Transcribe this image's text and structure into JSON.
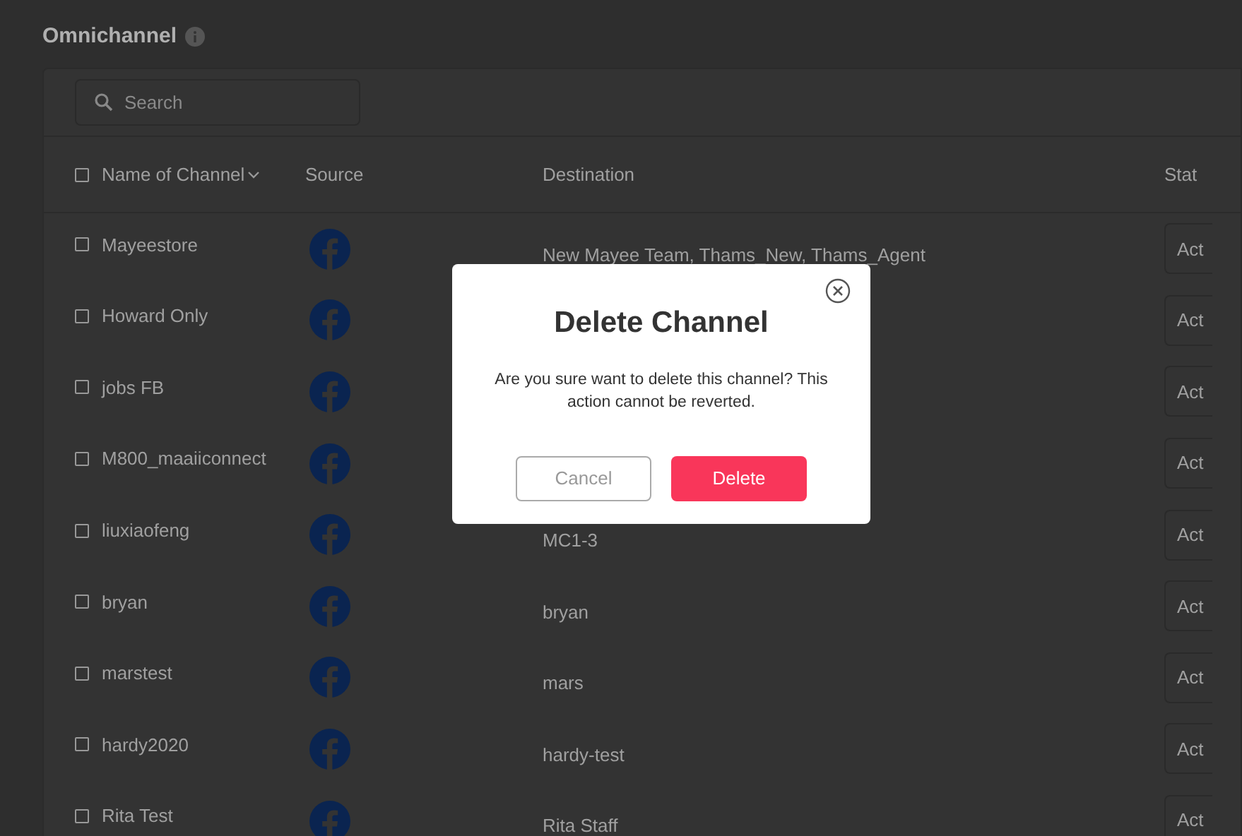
{
  "page": {
    "title": "Omnichannel"
  },
  "search": {
    "placeholder": "Search"
  },
  "table": {
    "select_all": {
      "checked": false
    },
    "columns": [
      "Name of Channel",
      "Source",
      "Destination",
      "Stat"
    ],
    "rows": [
      {
        "name": "Mayeestore",
        "checked": false,
        "destination": "New Mayee Team, Thams_New, Thams_Agent",
        "status": "Act"
      },
      {
        "name": "Howard Only",
        "checked": false,
        "status": "Act"
      },
      {
        "name": "jobs FB",
        "checked": false,
        "status": "Act"
      },
      {
        "name": "M800_maaiiconnect",
        "checked": false,
        "status": "Act"
      },
      {
        "name": "liuxiaofeng",
        "checked": false,
        "destination": "MC1-3",
        "status": "Act"
      },
      {
        "name": "bryan",
        "checked": false,
        "destination": "bryan",
        "status": "Act"
      },
      {
        "name": "marstest",
        "checked": false,
        "destination": "mars",
        "status": "Act"
      },
      {
        "name": "hardy2020",
        "checked": false,
        "destination": "hardy-test",
        "status": "Act"
      },
      {
        "name": "Rita Test",
        "checked": false,
        "destination": "Rita Staff",
        "status": "Act"
      }
    ]
  },
  "dialog": {
    "title": "Delete Channel",
    "message": "Are you sure want to delete this channel? This action cannot be reverted.",
    "cancel": "Cancel",
    "confirm": "Delete"
  }
}
